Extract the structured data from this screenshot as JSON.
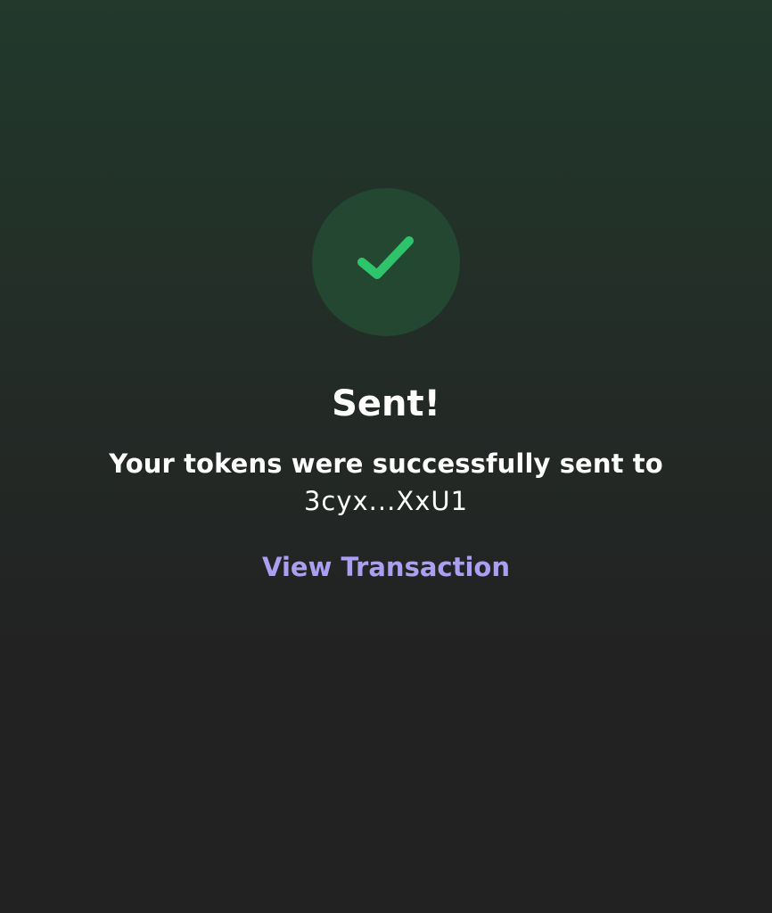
{
  "success": {
    "icon": "check-icon",
    "icon_color": "#2ec46b",
    "badge_color": "#244731",
    "title": "Sent!",
    "message": "Your tokens were successfully sent to",
    "recipient": "3cyx...XxU1",
    "link_label": "View Transaction",
    "link_color": "#ab9ff2"
  }
}
